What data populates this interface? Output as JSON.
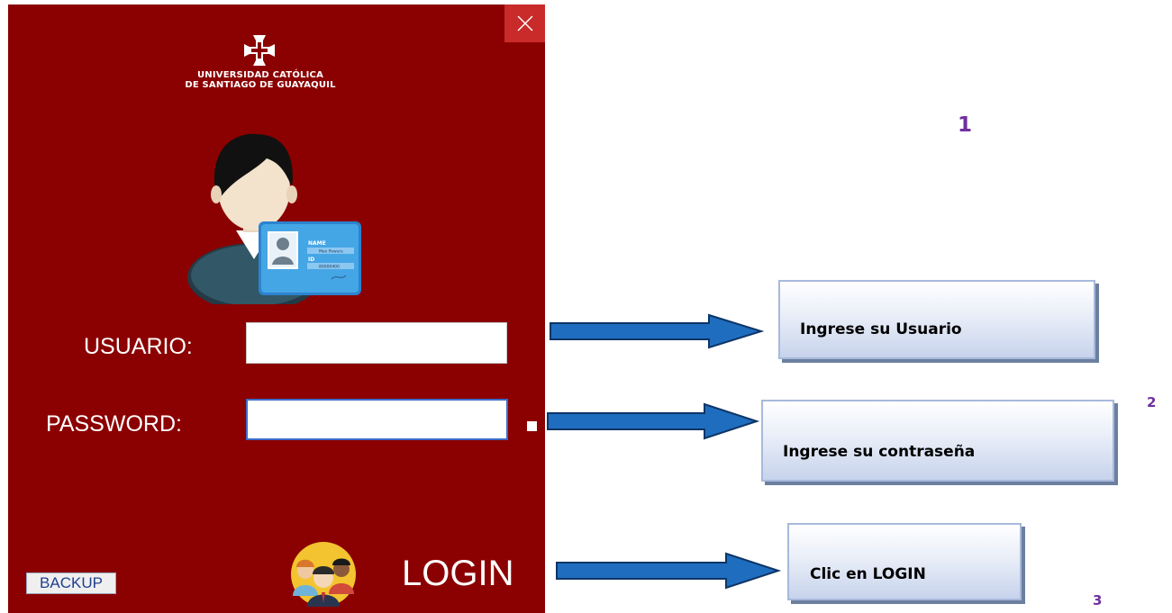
{
  "app": {
    "brand_line1": "UNIVERSIDAD CATÓLICA",
    "brand_line2": "DE SANTIAGO DE GUAYAQUIL",
    "window_bg": "#8B0000",
    "close_bg": "#C92A2A"
  },
  "form": {
    "usuario_label": "USUARIO:",
    "usuario_value": "",
    "password_label": "PASSWORD:",
    "password_value": ""
  },
  "footer": {
    "backup_label": "BACKUP",
    "login_label": "LOGIN"
  },
  "card": {
    "name_label": "NAME",
    "name_value": "Max Powers",
    "id_label": "ID",
    "id_value": "80000400"
  },
  "annotations": {
    "step1": "1",
    "step2": "2",
    "step3": "3",
    "callout_usuario": "Ingrese su Usuario",
    "callout_password": "Ingrese su contraseña",
    "callout_login": "Clic en LOGIN",
    "accent_color": "#7030A0",
    "arrow_color": "#1F6DBF"
  },
  "icons": [
    "close-icon",
    "university-logo-icon",
    "user-id-card-icon",
    "team-icon",
    "arrow-right-icon"
  ]
}
